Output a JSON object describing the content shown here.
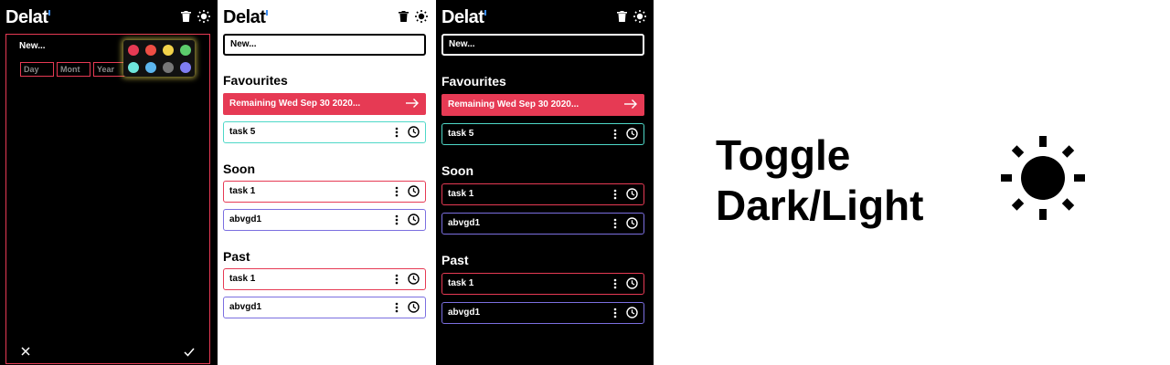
{
  "app": {
    "name": "Delat"
  },
  "colors": {
    "accent_red": "#e63a54",
    "accent_teal": "#4ed8c8",
    "accent_blue": "#7b6fe0",
    "logo_dot": "#3b8df5"
  },
  "editor": {
    "new_label": "New...",
    "day_placeholder": "Day",
    "month_placeholder": "Mont",
    "year_placeholder": "Year",
    "palette": [
      "#e63a54",
      "#ef4e44",
      "#f2d24a",
      "#5ccd6c",
      "#6ee6dc",
      "#5cb6ee",
      "#777777",
      "#7f7ef2"
    ],
    "close_icon": "close-icon",
    "confirm_icon": "check-icon"
  },
  "list": {
    "new_placeholder": "New...",
    "favourites_label": "Favourites",
    "soon_label": "Soon",
    "past_label": "Past",
    "banner_text": "Remaining Wed Sep 30 2020...",
    "favourites": [
      {
        "name": "task 5",
        "color": "#4ed8c8"
      }
    ],
    "soon": [
      {
        "name": "task 1",
        "color": "#e63a54"
      },
      {
        "name": "abvgd1",
        "color": "#7b6fe0"
      }
    ],
    "past": [
      {
        "name": "task 1",
        "color": "#e63a54"
      },
      {
        "name": "abvgd1",
        "color": "#7b6fe0"
      }
    ]
  },
  "promo": {
    "line1": "Toggle",
    "line2": "Dark/Light"
  }
}
